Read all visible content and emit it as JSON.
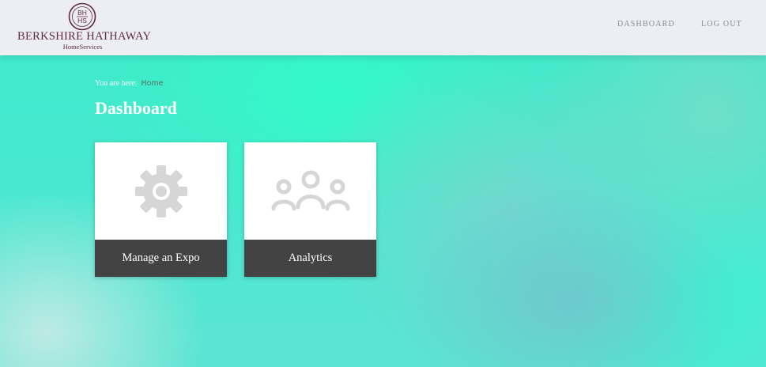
{
  "header": {
    "logo": {
      "seal_text_top": "BH",
      "seal_text_bottom": "HS",
      "name": "BERKSHIRE HATHAWAY",
      "sub": "HomeServices"
    },
    "nav": [
      {
        "label": "DASHBOARD"
      },
      {
        "label": "LOG OUT"
      }
    ]
  },
  "breadcrumb": {
    "prefix": "You are here:",
    "current": "Home"
  },
  "page": {
    "title": "Dashboard"
  },
  "cards": [
    {
      "label": "Manage an Expo",
      "icon": "gear-icon"
    },
    {
      "label": "Analytics",
      "icon": "users-icon"
    }
  ],
  "colors": {
    "brand": "#5d2a42",
    "header_bg": "#edeef4",
    "card_footer": "#434343",
    "icon_gray": "#d6d6d6"
  }
}
